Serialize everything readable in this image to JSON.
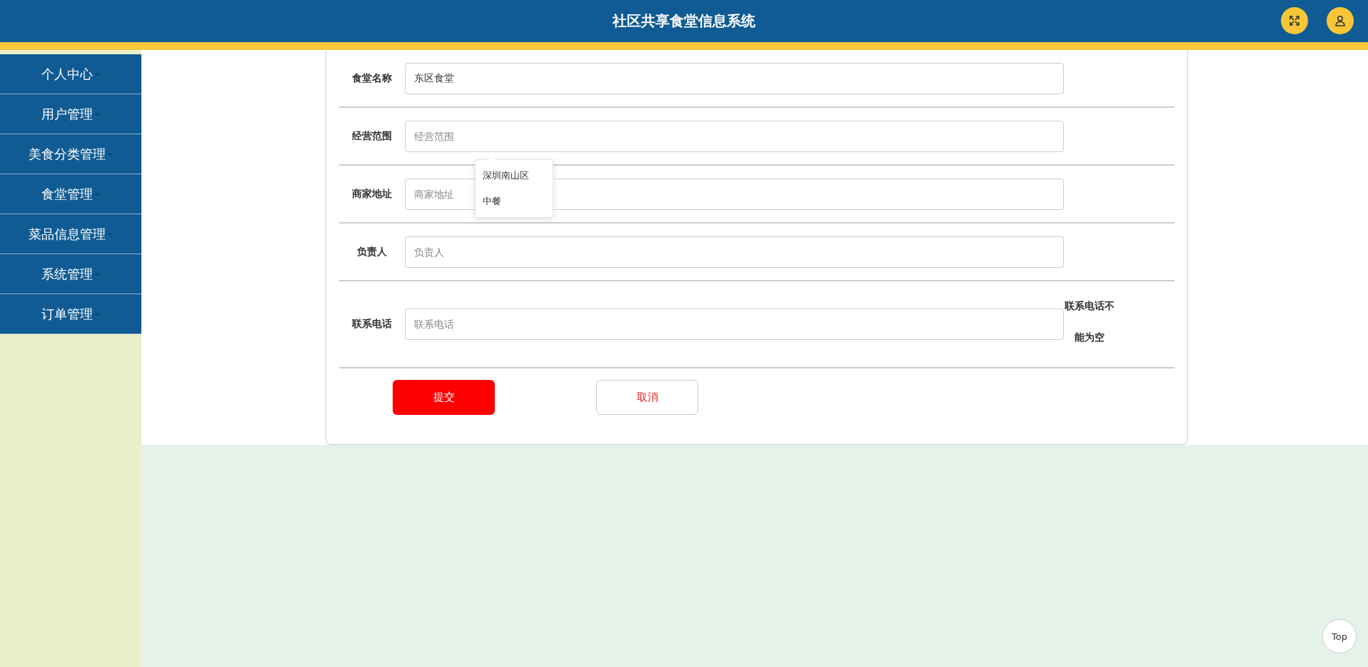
{
  "header": {
    "title": "社区共享食堂信息系统"
  },
  "sidebar": {
    "items": [
      {
        "label": "个人中心"
      },
      {
        "label": "用户管理"
      },
      {
        "label": "美食分类管理"
      },
      {
        "label": "食堂管理"
      },
      {
        "label": "菜品信息管理"
      },
      {
        "label": "系统管理"
      },
      {
        "label": "订单管理"
      }
    ]
  },
  "form": {
    "fields": [
      {
        "label": "食堂名称",
        "value": "东区食堂"
      },
      {
        "label": "经营范围",
        "placeholder": "经营范围",
        "suggestions": [
          "深圳南山区",
          "中餐"
        ]
      },
      {
        "label": "商家地址",
        "placeholder": "商家地址"
      },
      {
        "label": "负责人",
        "placeholder": "负责人"
      },
      {
        "label": "联系电话",
        "placeholder": "联系电话",
        "error": "联系电话不能为空"
      }
    ],
    "buttons": [
      {
        "label": "提交",
        "kind": "primary"
      },
      {
        "label": "取消",
        "kind": "secondary"
      }
    ]
  },
  "back_to_top": {
    "label": "Top"
  }
}
